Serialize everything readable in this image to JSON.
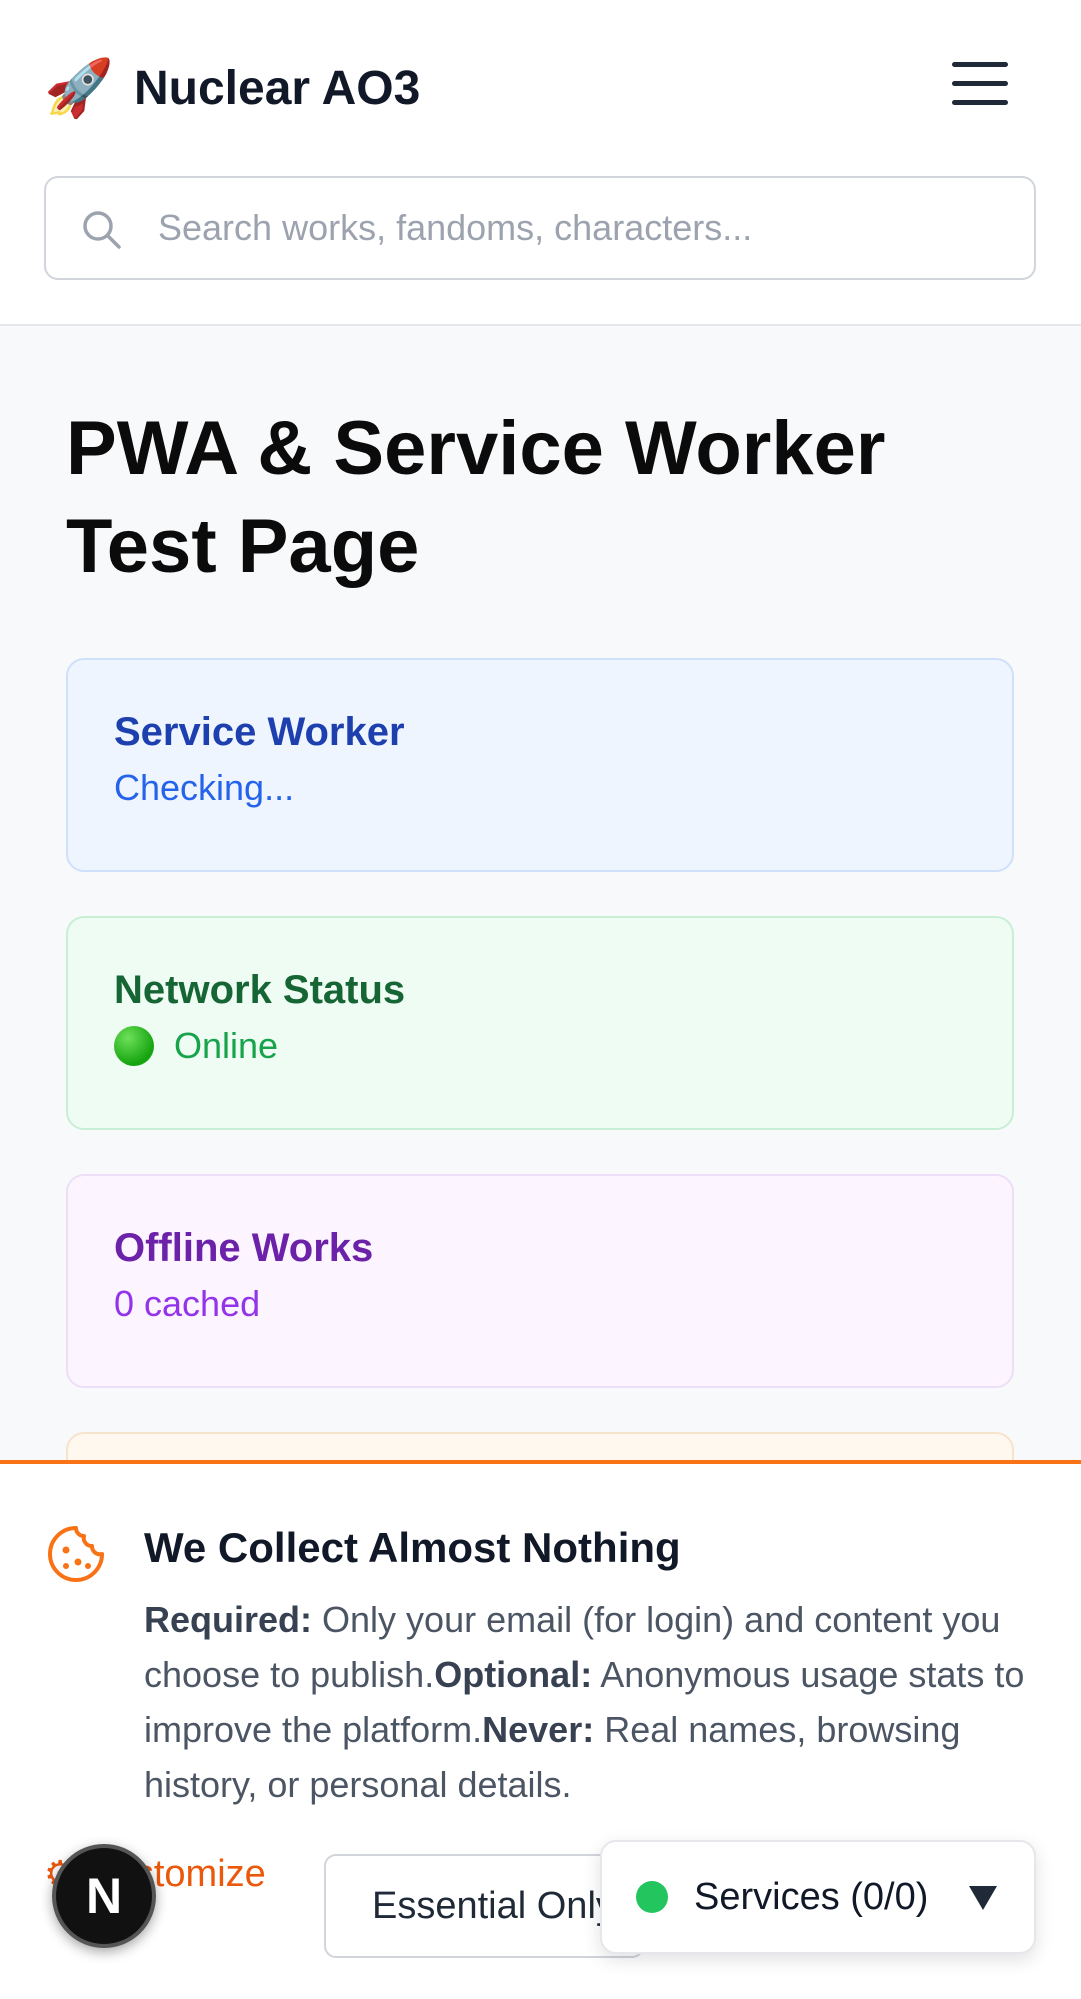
{
  "header": {
    "logo_icon": "rocket-icon",
    "app_title": "Nuclear AO3",
    "menu_icon": "hamburger-menu-icon",
    "search": {
      "placeholder": "Search works, fandoms, characters...",
      "value": ""
    }
  },
  "main": {
    "page_title": "PWA & Service Worker Test Page",
    "cards": {
      "service_worker": {
        "title": "Service Worker",
        "value": "Checking..."
      },
      "network_status": {
        "title": "Network Status",
        "value": "Online",
        "status_color": "#16a34a"
      },
      "offline_works": {
        "title": "Offline Works",
        "value": "0 cached"
      }
    }
  },
  "cookie_banner": {
    "icon": "cookie-icon",
    "title": "We Collect Almost Nothing",
    "required_label": "Required:",
    "required_text": "Only your email (for login) and content you choose to publish.",
    "optional_label": "Optional:",
    "optional_text": "Anonymous usage stats to improve the platform.",
    "never_label": "Never:",
    "never_text": "Real names, browsing history, or personal details.",
    "customize_label": "Customize",
    "essential_label": "Essential Only",
    "accent_color": "#f97316"
  },
  "services_widget": {
    "label": "Services (0/0)",
    "status_color": "#22c55e",
    "caret_icon": "caret-down-icon"
  },
  "dev_badge": {
    "letter": "N"
  }
}
